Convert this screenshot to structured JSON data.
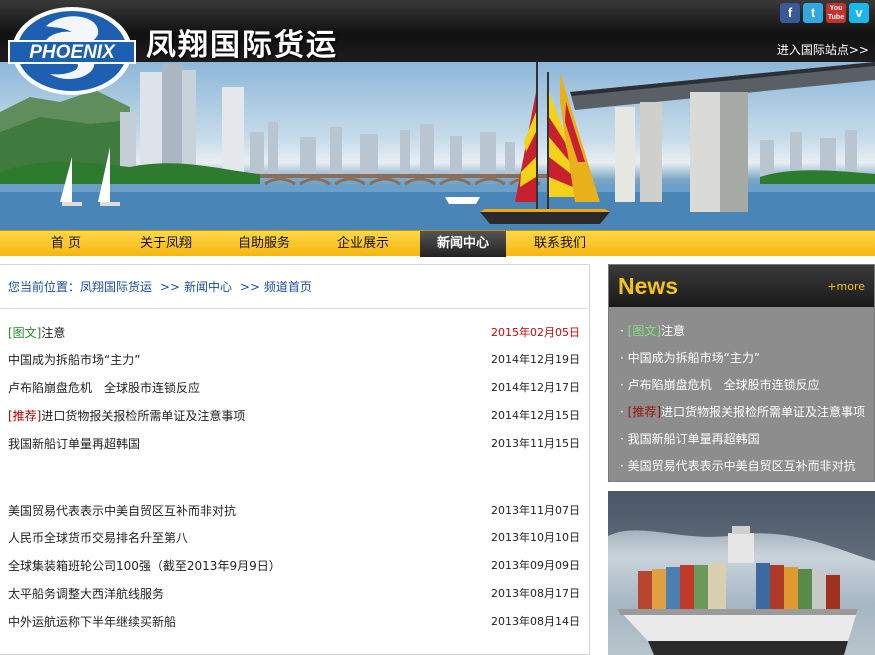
{
  "header": {
    "logo_text": "PHOENIX",
    "site_title": "凤翔国际货运",
    "intl_link": "进入国际站点>>",
    "social": [
      {
        "name": "facebook",
        "glyph": "f"
      },
      {
        "name": "twitter",
        "glyph": "t"
      },
      {
        "name": "youtube",
        "glyph": "You Tube"
      },
      {
        "name": "vimeo",
        "glyph": "v"
      }
    ]
  },
  "nav": {
    "items": [
      "首 页",
      "关于凤翔",
      "自助服务",
      "企业展示",
      "新闻中心",
      "联系我们"
    ],
    "active": "新闻中心"
  },
  "breadcrumb": {
    "prefix": "您当前位置：",
    "path": [
      "凤翔国际货运",
      "新闻中心",
      "频道首页"
    ],
    "sep": ">>"
  },
  "articles": [
    {
      "tag": "[图文]",
      "title": "注意",
      "date": "2015年02月05日"
    },
    {
      "tag": "",
      "title": "中国成为拆船市场“主力”",
      "date": "2014年12月19日"
    },
    {
      "tag": "",
      "title": "卢布陷崩盘危机　全球股市连锁反应",
      "date": "2014年12月17日"
    },
    {
      "tag": "[推荐]",
      "title": "进口货物报关报检所需单证及注意事项",
      "date": "2014年12月15日"
    },
    {
      "tag": "",
      "title": "我国新船订单量再超韩国",
      "date": "2013年11月15日"
    },
    {
      "tag": "",
      "title": "美国贸易代表表示中美自贸区互补而非对抗",
      "date": "2013年11月07日"
    },
    {
      "tag": "",
      "title": "人民币全球货币交易排名升至第八",
      "date": "2013年10月10日"
    },
    {
      "tag": "",
      "title": "全球集装箱班轮公司100强（截至2013年9月9日）",
      "date": "2013年09月09日"
    },
    {
      "tag": "",
      "title": "太平船务调整大西洋航线服务",
      "date": "2013年08月17日"
    },
    {
      "tag": "",
      "title": "中外运航运称下半年继续买新船",
      "date": "2013年08月14日"
    }
  ],
  "sidebar": {
    "title": "News",
    "more": "+more",
    "items": [
      {
        "tag": "[图文]",
        "title": "注意"
      },
      {
        "tag": "",
        "title": "中国成为拆船市场“主力”"
      },
      {
        "tag": "",
        "title": "卢布陷崩盘危机　全球股市连锁反应"
      },
      {
        "tag": "[推荐]",
        "title": "进口货物报关报检所需单证及注意事项"
      },
      {
        "tag": "",
        "title": "我国新船订单量再超韩国"
      },
      {
        "tag": "",
        "title": "美国贸易代表表示中美自贸区互补而非对抗"
      }
    ],
    "bullet": "·"
  },
  "colors": {
    "nav_bg": "#f4b60e",
    "accent_gold": "#f6c21a",
    "link_blue": "#1a4f9c",
    "latest_date_red": "#d40000"
  }
}
